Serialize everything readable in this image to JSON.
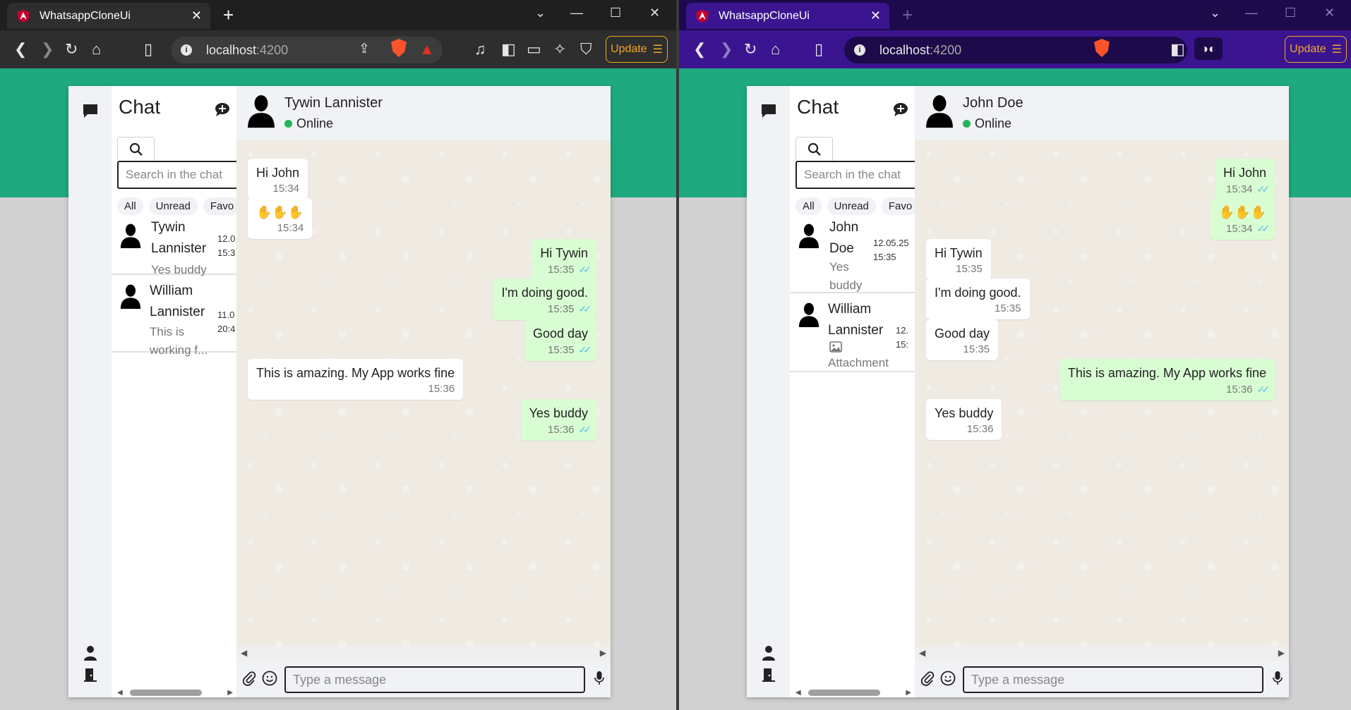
{
  "windows": [
    {
      "tab_title": "WhatsappCloneUi",
      "url_host": "localhost",
      "url_port": ":4200",
      "update_label": "Update",
      "sidebar": {
        "title": "Chat",
        "search_placeholder": "Search in the chat",
        "filters": [
          "All",
          "Unread",
          "Favo"
        ],
        "chats": [
          {
            "name": "Tywin Lannister",
            "preview": "Yes buddy",
            "time_date": "12.0",
            "time_clock": "15:3"
          },
          {
            "name": "William Lannister",
            "preview": "This is working f...",
            "time_date": "11.0",
            "time_clock": "20:4"
          }
        ]
      },
      "header": {
        "name": "Tywin Lannister",
        "status": "Online"
      },
      "messages": [
        {
          "text": "Hi John",
          "time": "15:34",
          "dir": "in",
          "ticks": false
        },
        {
          "text": "✋✋✋",
          "time": "15:34",
          "dir": "in",
          "ticks": false
        },
        {
          "text": "Hi Tywin",
          "time": "15:35",
          "dir": "out",
          "ticks": true
        },
        {
          "text": "I'm doing good.",
          "time": "15:35",
          "dir": "out",
          "ticks": true
        },
        {
          "text": "Good day",
          "time": "15:35",
          "dir": "out",
          "ticks": true
        },
        {
          "text": "This is amazing. My App works fine",
          "time": "15:36",
          "dir": "in",
          "ticks": false
        },
        {
          "text": "Yes buddy",
          "time": "15:36",
          "dir": "out",
          "ticks": true
        }
      ],
      "compose_placeholder": "Type a message"
    },
    {
      "tab_title": "WhatsappCloneUi",
      "url_host": "localhost",
      "url_port": ":4200",
      "update_label": "Update",
      "sidebar": {
        "title": "Chat",
        "search_placeholder": "Search in the chat",
        "filters": [
          "All",
          "Unread",
          "Favo"
        ],
        "chats": [
          {
            "name": "John Doe",
            "preview": "Yes buddy",
            "time_date": "12.05.25",
            "time_clock": "15:35"
          },
          {
            "name": "William Lannister",
            "preview": "Attachment",
            "time_date": "12.",
            "time_clock": "15:"
          }
        ]
      },
      "header": {
        "name": "John Doe",
        "status": "Online"
      },
      "messages": [
        {
          "text": "Hi John",
          "time": "15:34",
          "dir": "out",
          "ticks": true
        },
        {
          "text": "✋✋✋",
          "time": "15:34",
          "dir": "out",
          "ticks": true
        },
        {
          "text": "Hi Tywin",
          "time": "15:35",
          "dir": "in",
          "ticks": false
        },
        {
          "text": "I'm doing good.",
          "time": "15:35",
          "dir": "in",
          "ticks": false
        },
        {
          "text": "Good day",
          "time": "15:35",
          "dir": "in",
          "ticks": false
        },
        {
          "text": "This is amazing. My App works fine",
          "time": "15:36",
          "dir": "out",
          "ticks": true
        },
        {
          "text": "Yes buddy",
          "time": "15:36",
          "dir": "in",
          "ticks": false
        }
      ],
      "compose_placeholder": "Type a message"
    }
  ],
  "colors": {
    "banner": "#1ea97f",
    "incoming_bubble": "#ffffff",
    "outgoing_bubble": "#d9fdd3",
    "online": "#22b45a",
    "read_ticks": "#53bdeb",
    "update_accent": "#f0a623"
  },
  "icons": [
    "chat-icon",
    "new-chat-icon",
    "search-icon",
    "user-icon",
    "logout-icon",
    "attach-icon",
    "emoji-icon",
    "mic-icon",
    "image-icon",
    "avatar-silhouette"
  ]
}
